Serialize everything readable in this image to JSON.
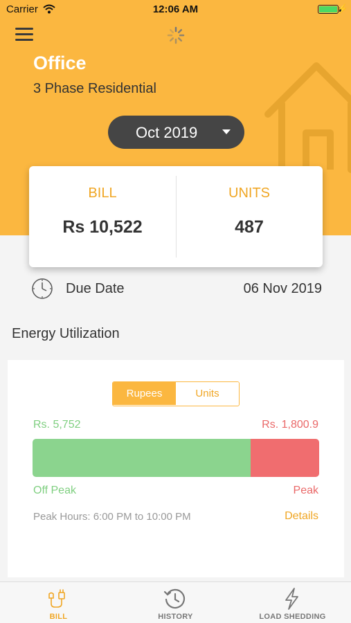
{
  "status_bar": {
    "carrier": "Carrier",
    "time": "12:06 AM"
  },
  "header": {
    "site_name": "Office",
    "connection_type": "3 Phase Residential",
    "selected_month": "Oct 2019"
  },
  "summary": {
    "bill_label": "BILL",
    "bill_value": "Rs 10,522",
    "units_label": "UNITS",
    "units_value": "487"
  },
  "due": {
    "label": "Due Date",
    "value": "06 Nov 2019"
  },
  "energy": {
    "section_title": "Energy Utilization",
    "toggle": {
      "options": [
        "Rupees",
        "Units"
      ],
      "selected": "Rupees"
    },
    "off_peak_amount": "Rs. 5,752",
    "peak_amount": "Rs. 1,800.9",
    "off_peak_value": 5752,
    "peak_value": 1800.9,
    "off_peak_label": "Off Peak",
    "peak_label": "Peak",
    "peak_hours": "Peak Hours: 6:00 PM to 10:00 PM",
    "details_label": "Details"
  },
  "tabs": [
    {
      "label": "BILL",
      "icon": "plug-icon",
      "active": true
    },
    {
      "label": "HISTORY",
      "icon": "history-icon",
      "active": false
    },
    {
      "label": "LOAD SHEDDING",
      "icon": "lightning-icon",
      "active": false
    }
  ],
  "colors": {
    "brand": "#fbb740",
    "accent_text": "#f0a623",
    "off_peak": "#8bd48e",
    "peak": "#f06d6f",
    "dark_pill": "#454545"
  }
}
